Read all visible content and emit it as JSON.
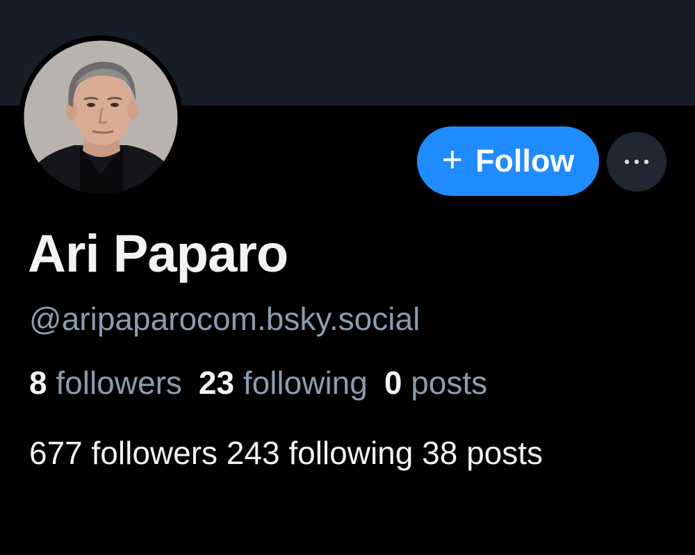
{
  "profile": {
    "display_name": "Ari Paparo",
    "handle": "@aripaparocom.bsky.social",
    "avatar_icon": "profile-photo"
  },
  "actions": {
    "follow_plus": "+",
    "follow_label": "Follow",
    "more_icon": "ellipsis-icon"
  },
  "stats": {
    "followers_count": "8",
    "followers_label": "followers",
    "following_count": "23",
    "following_label": "following",
    "posts_count": "0",
    "posts_label": "posts"
  },
  "bio": {
    "text": "677 followers 243 following 38 posts"
  },
  "colors": {
    "banner": "#161e27",
    "background": "#000000",
    "accent": "#208bfe",
    "muted_text": "#8c9cb0",
    "primary_text": "#f1f3f5"
  }
}
